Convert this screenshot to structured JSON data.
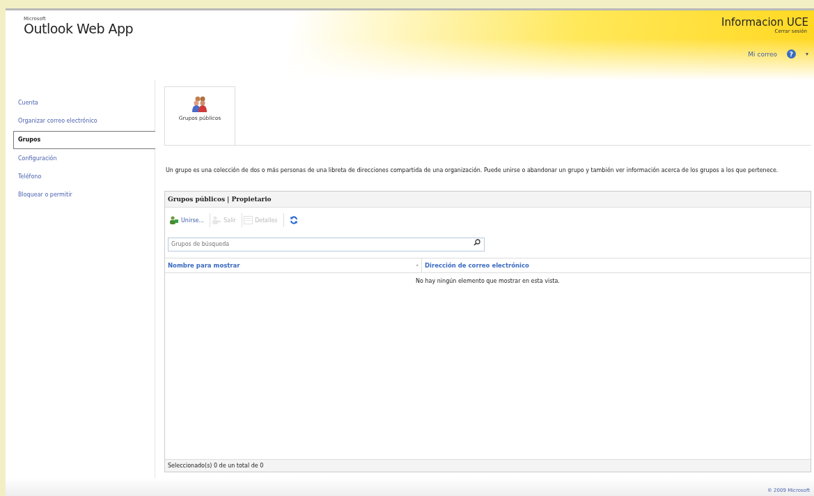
{
  "header": {
    "brand_small": "Microsoft",
    "brand": "Outlook Web App",
    "user": "Informacion UCE",
    "sign_out": "Cerrar sesión",
    "my_mail": "Mi correo",
    "help_icon": "?",
    "help_caret": "▾"
  },
  "sidebar": {
    "items": [
      {
        "label": "Cuenta",
        "selected": false
      },
      {
        "label": "Organizar correo electrónico",
        "selected": false
      },
      {
        "label": "Grupos",
        "selected": true
      },
      {
        "label": "Configuración",
        "selected": false
      },
      {
        "label": "Teléfono",
        "selected": false
      },
      {
        "label": "Bloquear o permitir",
        "selected": false
      }
    ]
  },
  "tabs": [
    {
      "label": "Grupos públicos",
      "selected": true
    }
  ],
  "description": "Un grupo es una colección de dos o más personas de una libreta de direcciones compartida de una organización. Puede unirse o abandonar un grupo y también ver información acerca de los grupos a los que pertenece.",
  "panel": {
    "title": "Grupos públicos | Propietario",
    "toolbar": [
      {
        "kind": "join",
        "label": "Unirse...",
        "disabled": false
      },
      {
        "kind": "leave",
        "label": "Salir",
        "disabled": true
      },
      {
        "kind": "details",
        "label": "Detalles",
        "disabled": true
      },
      {
        "kind": "refresh",
        "disabled": false
      }
    ],
    "search": {
      "placeholder": "Grupos de búsqueda"
    },
    "table": {
      "columns": [
        "Nombre para mostrar",
        "Dirección de correo electrónico"
      ],
      "sort_caret": "▴",
      "empty_message": "No hay ningún elemento que mostrar en esta vista."
    },
    "status_bar": "Seleccionado(s) 0 de un total de 0"
  },
  "footer": "© 2009 Microsoft"
}
